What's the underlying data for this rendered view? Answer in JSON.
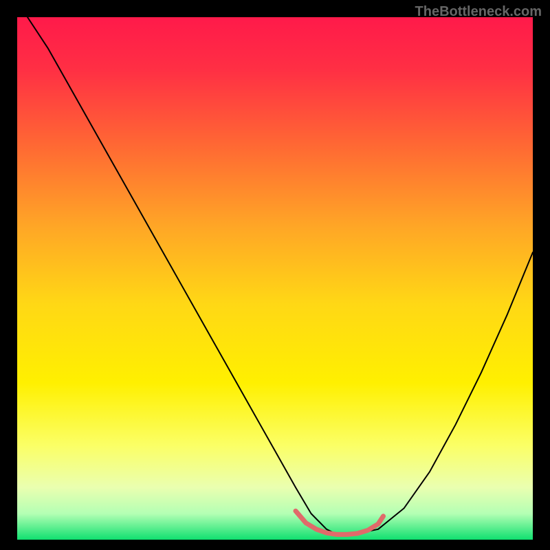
{
  "watermark": "TheBottleneck.com",
  "chart_data": {
    "type": "line",
    "title": "",
    "xlabel": "",
    "ylabel": "",
    "xlim": [
      0,
      100
    ],
    "ylim": [
      0,
      100
    ],
    "background_gradient": {
      "stops": [
        {
          "offset": 0.0,
          "color": "#ff1a4a"
        },
        {
          "offset": 0.1,
          "color": "#ff2f44"
        },
        {
          "offset": 0.25,
          "color": "#ff6a33"
        },
        {
          "offset": 0.4,
          "color": "#ffa626"
        },
        {
          "offset": 0.55,
          "color": "#ffd815"
        },
        {
          "offset": 0.7,
          "color": "#fff000"
        },
        {
          "offset": 0.82,
          "color": "#fbff66"
        },
        {
          "offset": 0.9,
          "color": "#eaffb0"
        },
        {
          "offset": 0.95,
          "color": "#b4ffb4"
        },
        {
          "offset": 1.0,
          "color": "#10e070"
        }
      ]
    },
    "series": [
      {
        "name": "bottleneck-curve",
        "color": "#000000",
        "width": 2,
        "x": [
          2,
          6,
          10,
          14,
          18,
          22,
          26,
          30,
          34,
          38,
          42,
          46,
          50,
          54,
          57,
          60,
          62,
          65,
          70,
          75,
          80,
          85,
          90,
          95,
          100
        ],
        "y": [
          100,
          94,
          87,
          80,
          73,
          66,
          59,
          52,
          45,
          38,
          31,
          24,
          17,
          10,
          5,
          2,
          1,
          1,
          2,
          6,
          13,
          22,
          32,
          43,
          55
        ]
      },
      {
        "name": "optimal-zone-marker",
        "color": "#e06a6a",
        "width": 7,
        "x": [
          54,
          56,
          58,
          60,
          62,
          64,
          66,
          68,
          70,
          71
        ],
        "y": [
          5.5,
          3.2,
          2.0,
          1.3,
          1.0,
          1.0,
          1.2,
          1.8,
          3.0,
          4.5
        ]
      }
    ]
  }
}
